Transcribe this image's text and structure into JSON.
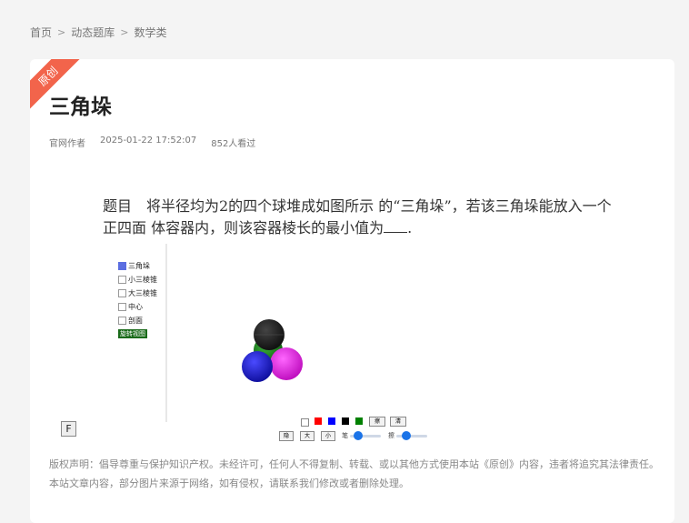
{
  "breadcrumb": {
    "home": "首页",
    "sep": ">",
    "category": "动态题库",
    "subcategory": "数学类"
  },
  "article": {
    "badge": "原创",
    "title": "三角垛",
    "author": "官网作者",
    "date": "2025-01-22 17:52:07",
    "views": "852人看过",
    "problem_text_1": "题目　将半径均为2的四个球堆成如图所示 的“三角垛”，若该三角垛能放入一个正四面 体容器内，则该容器棱长的最小值为",
    "problem_text_2": "."
  },
  "applet": {
    "checkboxes": [
      {
        "label": "三角垛",
        "checked": true
      },
      {
        "label": "小三棱锥",
        "checked": false
      },
      {
        "label": "大三棱锥",
        "checked": false
      },
      {
        "label": "中心",
        "checked": false
      },
      {
        "label": "剖面",
        "checked": false
      }
    ],
    "green_button": "旋转视图",
    "f_button": "F",
    "color_swatches": [
      "#ff0000",
      "#0000ff",
      "#000000",
      "#008000"
    ],
    "btn_erase": "擦",
    "btn_clear": "清",
    "btn_hide": "隐",
    "btn_big": "大",
    "btn_small": "小",
    "slider_label_1": "笔",
    "slider_label_2": "擦",
    "slider_1_value": 0.3,
    "slider_2_value": 0.3,
    "sphere_colors": [
      "#1a1a1a",
      "#1a8a1a",
      "#2020dd",
      "#dd22dd"
    ]
  },
  "copyright": "版权声明：倡导尊重与保护知识产权。未经许可，任何人不得复制、转载、或以其他方式使用本站《原创》内容，违者将追究其法律责任。本站文章内容，部分图片来源于网络，如有侵权，请联系我们修改或者删除处理。"
}
